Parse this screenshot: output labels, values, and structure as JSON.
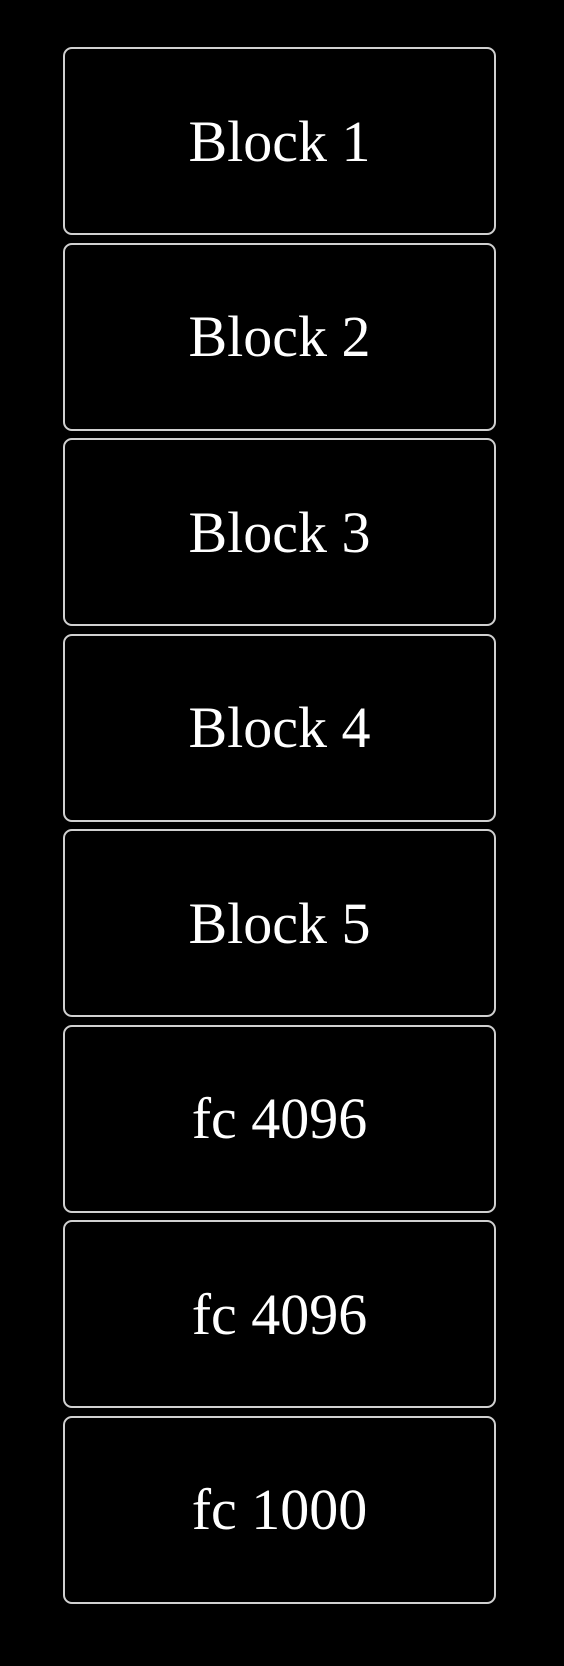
{
  "blocks": [
    {
      "label": "Block 1"
    },
    {
      "label": "Block 2"
    },
    {
      "label": "Block 3"
    },
    {
      "label": "Block 4"
    },
    {
      "label": "Block 5"
    },
    {
      "label": "fc 4096"
    },
    {
      "label": "fc 4096"
    },
    {
      "label": "fc 1000"
    }
  ],
  "colors": {
    "background": "#000000",
    "border": "#d0d0d0",
    "text": "#ffffff"
  }
}
